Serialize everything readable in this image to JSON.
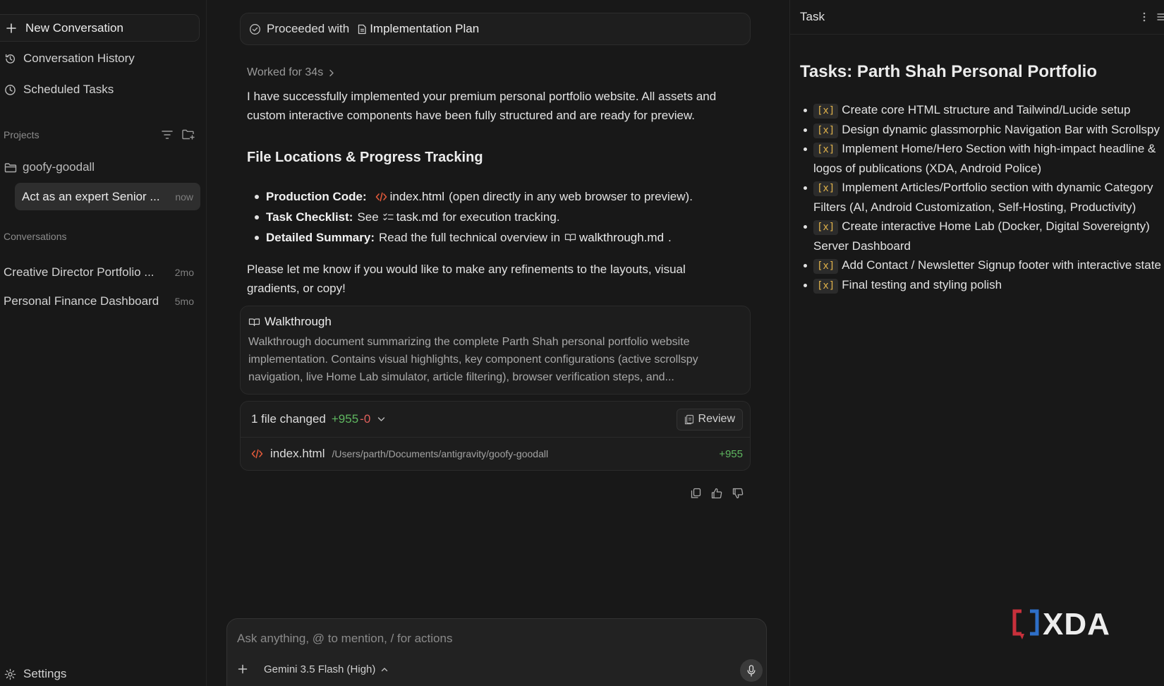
{
  "sidebar": {
    "new_conversation": "New Conversation",
    "history": "Conversation History",
    "scheduled": "Scheduled Tasks",
    "projects_label": "Projects",
    "project_name": "goofy-goodall",
    "active_conversation": {
      "title": "Act as an expert Senior ...",
      "time": "now"
    },
    "conversations_label": "Conversations",
    "conversations": [
      {
        "title": "Creative Director Portfolio ...",
        "time": "2mo"
      },
      {
        "title": "Personal Finance Dashboard",
        "time": "5mo"
      }
    ],
    "settings": "Settings"
  },
  "main": {
    "proceeded_with": "Proceeded with",
    "plan_doc": "Implementation Plan",
    "worked_for": "Worked for 34s",
    "intro": "I have successfully implemented your premium personal portfolio website. All assets and custom interactive components have been fully structured and are ready for preview.",
    "section_heading": "File Locations & Progress Tracking",
    "bullets": [
      {
        "label": "Production Code:",
        "file": "index.html",
        "suffix": "(open directly in any web browser to preview).",
        "icon": "code-icon"
      },
      {
        "label": "Task Checklist:",
        "prefix": "See",
        "file": "task.md",
        "suffix": "for execution tracking.",
        "icon": "checklist-icon"
      },
      {
        "label": "Detailed Summary:",
        "prefix": "Read the full technical overview in",
        "file": "walkthrough.md",
        "suffix": ".",
        "icon": "book-icon"
      }
    ],
    "closing": "Please let me know if you would like to make any refinements to the layouts, visual gradients, or copy!",
    "walkthrough": {
      "title": "Walkthrough",
      "body": "Walkthrough document summarizing the complete Parth Shah personal portfolio website implementation. Contains visual highlights, key component configurations (active scrollspy navigation, live Home Lab simulator, article filtering), browser verification steps, and..."
    },
    "changes": {
      "summary": "1 file changed",
      "added": "+955",
      "removed": "-0",
      "review": "Review",
      "file_name": "index.html",
      "file_path": "/Users/parth/Documents/antigravity/goofy-goodall",
      "file_added": "+955"
    },
    "composer": {
      "placeholder": "Ask anything, @ to mention, / for actions",
      "model": "Gemini 3.5 Flash (High)"
    }
  },
  "task_panel": {
    "header": "Task",
    "title": "Tasks: Parth Shah Personal Portfolio",
    "checkbox": "[x]",
    "items": [
      "Create core HTML structure and Tailwind/Lucide setup",
      "Design dynamic glassmorphic Navigation Bar with Scrollspy",
      "Implement Home/Hero Section with high-impact headline & logos of publications (XDA, Android Police)",
      "Implement Articles/Portfolio section with dynamic Category Filters (AI, Android Customization, Self-Hosting, Productivity)",
      "Create interactive Home Lab (Docker, Digital Sovereignty) Server Dashboard",
      "Add Contact / Newsletter Signup footer with interactive state",
      "Final testing and styling polish"
    ]
  },
  "watermark": "XDA",
  "colors": {
    "added": "#5fb760",
    "removed": "#e0605c",
    "checkbox": "#e2b34a",
    "code_icon": "#e0593a"
  }
}
